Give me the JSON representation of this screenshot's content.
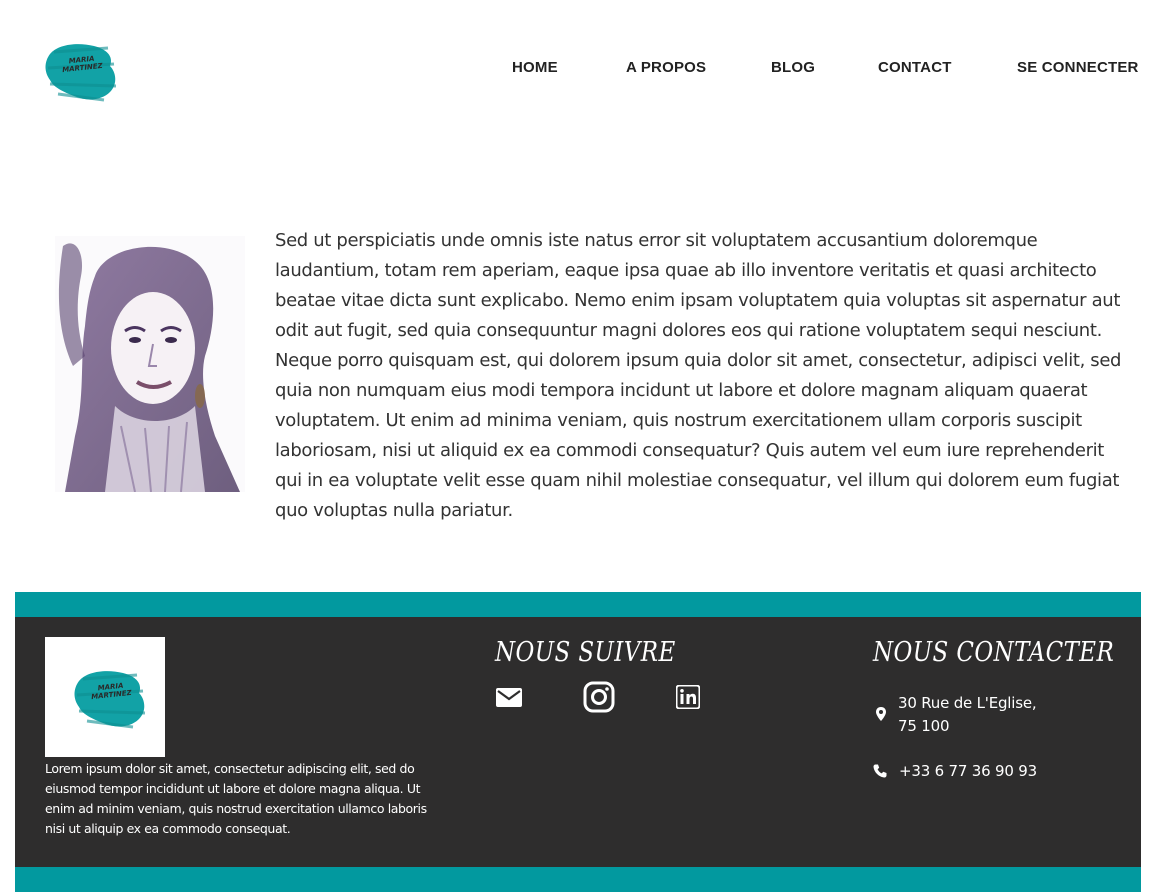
{
  "brand": {
    "logo_text_line1": "MARIA",
    "logo_text_line2": "MARTINEZ",
    "accent_color": "#02999f",
    "footer_bg_color": "#2e2d2d"
  },
  "nav": {
    "items": [
      {
        "label": "HOME"
      },
      {
        "label": "A PROPOS"
      },
      {
        "label": "BLOG"
      },
      {
        "label": "CONTACT"
      },
      {
        "label": "SE CONNECTER"
      }
    ]
  },
  "about": {
    "portrait_icon": "portrait-sketch-image",
    "text": "Sed ut perspiciatis unde omnis iste natus error sit voluptatem accusantium doloremque laudantium, totam rem aperiam, eaque ipsa quae ab illo inventore veritatis et quasi architecto beatae vitae dicta sunt explicabo. Nemo enim ipsam voluptatem quia voluptas sit aspernatur aut odit aut fugit, sed quia consequuntur magni dolores eos qui ratione voluptatem sequi nesciunt. Neque porro quisquam est, qui dolorem ipsum quia dolor sit amet, consectetur, adipisci velit, sed quia non numquam eius modi tempora incidunt ut labore et dolore magnam aliquam quaerat voluptatem. Ut enim ad minima veniam, quis nostrum exercitationem ullam corporis suscipit laboriosam, nisi ut aliquid ex ea commodi consequatur? Quis autem vel eum iure reprehenderit qui in ea voluptate velit esse quam nihil molestiae consequatur, vel illum qui dolorem eum fugiat quo voluptas nulla pariatur."
  },
  "footer": {
    "description": "Lorem ipsum dolor sit amet, consectetur adipiscing elit, sed do eiusmod tempor incididunt ut labore et dolore magna aliqua. Ut enim ad minim veniam, quis nostrud exercitation ullamco laboris nisi ut aliquip ex ea commodo consequat.",
    "follow_heading": "NOUS SUIVRE",
    "contact_heading": "NOUS CONTACTER",
    "social_icons": [
      "mail-icon",
      "instagram-icon",
      "linkedin-icon"
    ],
    "address_line1": "30 Rue de L'Eglise,",
    "address_line2": "75 100",
    "phone": "+33 6 77 36 90 93"
  }
}
